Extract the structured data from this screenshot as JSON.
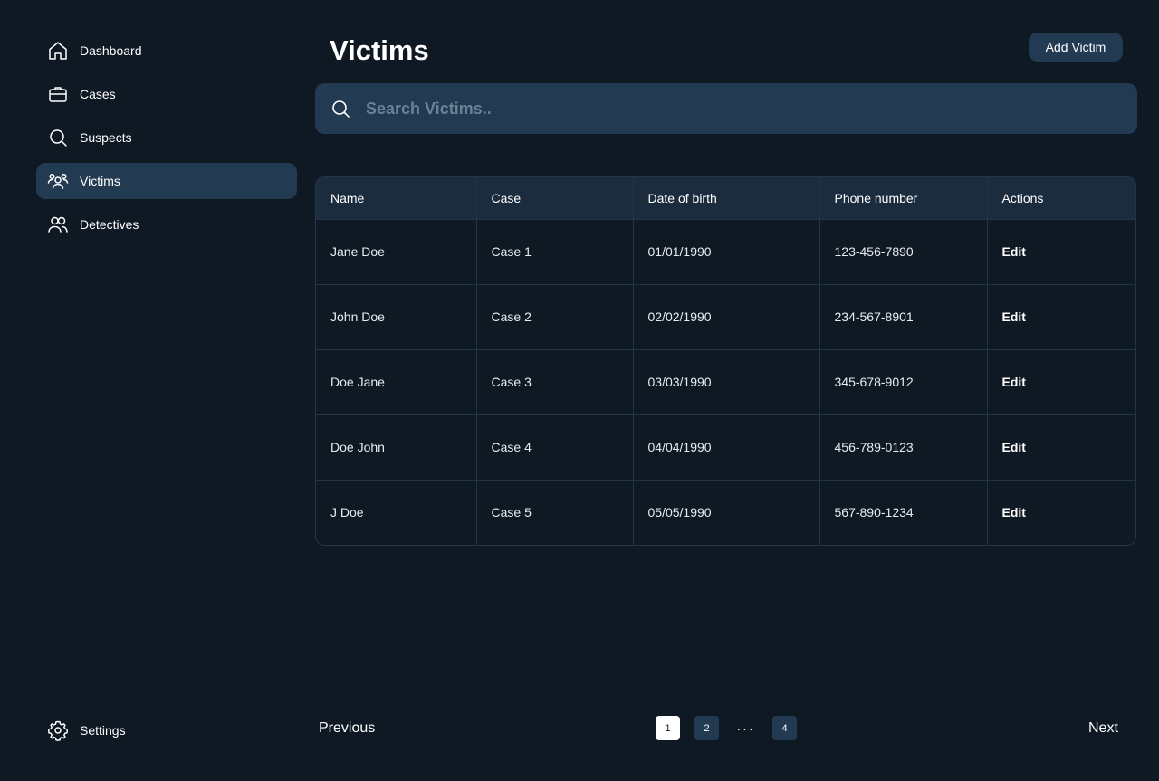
{
  "sidebar": {
    "items": [
      {
        "label": "Dashboard",
        "icon": "home-icon"
      },
      {
        "label": "Cases",
        "icon": "briefcase-icon"
      },
      {
        "label": "Suspects",
        "icon": "search-icon"
      },
      {
        "label": "Victims",
        "icon": "users-group-icon",
        "active": true
      },
      {
        "label": "Detectives",
        "icon": "users-icon"
      }
    ],
    "settings_label": "Settings"
  },
  "header": {
    "title": "Victims",
    "add_button_label": "Add Victim"
  },
  "search": {
    "placeholder": "Search Victims..",
    "value": ""
  },
  "table": {
    "columns": [
      "Name",
      "Case",
      "Date of birth",
      "Phone number",
      "Actions"
    ],
    "rows": [
      {
        "name": "Jane Doe",
        "case": "Case 1",
        "dob": "01/01/1990",
        "phone": "123-456-7890",
        "action": "Edit"
      },
      {
        "name": "John Doe",
        "case": "Case 2",
        "dob": "02/02/1990",
        "phone": "234-567-8901",
        "action": "Edit"
      },
      {
        "name": "Doe Jane",
        "case": "Case 3",
        "dob": "03/03/1990",
        "phone": "345-678-9012",
        "action": "Edit"
      },
      {
        "name": "Doe John",
        "case": "Case 4",
        "dob": "04/04/1990",
        "phone": "456-789-0123",
        "action": "Edit"
      },
      {
        "name": "J Doe",
        "case": "Case 5",
        "dob": "05/05/1990",
        "phone": "567-890-1234",
        "action": "Edit"
      }
    ]
  },
  "pagination": {
    "previous_label": "Previous",
    "next_label": "Next",
    "pages": [
      "1",
      "2",
      "4"
    ],
    "ellipsis": "···",
    "current": "1"
  },
  "colors": {
    "background": "#0f1924",
    "surface": "#223a52",
    "table_header": "#1b2c3e",
    "border": "#22364a",
    "placeholder": "#6b8296"
  }
}
